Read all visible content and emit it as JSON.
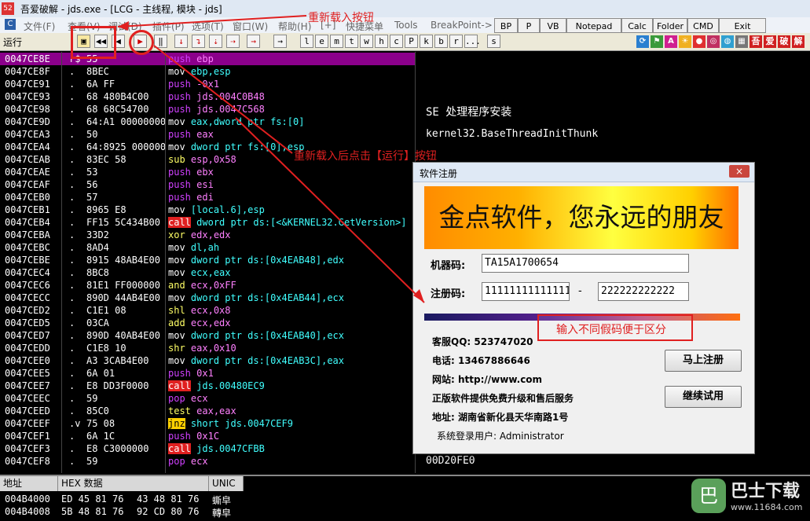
{
  "window": {
    "title": "吾爱破解 - jds.exe - [LCG - 主线程, 模块 - jds]",
    "icon": "52"
  },
  "menu": {
    "items": [
      "文件(F)",
      "查看(V)",
      "调试(D)",
      "插件(P)",
      "选项(T)",
      "窗口(W)",
      "帮助(H)",
      "[+]",
      "快捷菜单",
      "Tools",
      "BreakPoint->"
    ]
  },
  "plugin_buttons": [
    "BP",
    "P",
    "VB",
    "Notepad",
    "Calc",
    "Folder",
    "CMD",
    "Exit"
  ],
  "toolbar": {
    "status": "运行",
    "letters": [
      "l",
      "e",
      "m",
      "t",
      "w",
      "h",
      "c",
      "P",
      "k",
      "b",
      "r",
      "...",
      "s"
    ]
  },
  "disasm_rows": [
    {
      "addr": "0047CE8E",
      "mark": "r$",
      "hex": "55",
      "op": "push",
      "args": "ebp",
      "cls": "kw-push"
    },
    {
      "addr": "0047CE8F",
      "mark": ".",
      "hex": "8BEC",
      "op": "mov",
      "args": "ebp,esp",
      "cls": "kw-mov"
    },
    {
      "addr": "0047CE91",
      "mark": ".",
      "hex": "6A FF",
      "op": "push",
      "args": "-0x1",
      "cls": "kw-push"
    },
    {
      "addr": "0047CE93",
      "mark": ".",
      "hex": "68 480B4C00",
      "op": "push",
      "args": "jds.004C0B48",
      "cls": "kw-push"
    },
    {
      "addr": "0047CE98",
      "mark": ".",
      "hex": "68 68C54700",
      "op": "push",
      "args": "jds.0047C568",
      "cls": "kw-push"
    },
    {
      "addr": "0047CE9D",
      "mark": ".",
      "hex": "64:A1 00000000",
      "op": "mov",
      "args": "eax,dword ptr fs:[0]",
      "cls": "kw-mov"
    },
    {
      "addr": "0047CEA3",
      "mark": ".",
      "hex": "50",
      "op": "push",
      "args": "eax",
      "cls": "kw-push"
    },
    {
      "addr": "0047CEA4",
      "mark": ".",
      "hex": "64:8925 00000000",
      "op": "mov",
      "args": "dword ptr fs:[0],esp",
      "cls": "kw-mov"
    },
    {
      "addr": "0047CEAB",
      "mark": ".",
      "hex": "83EC 58",
      "op": "sub",
      "args": "esp,0x58",
      "cls": "kw-arith"
    },
    {
      "addr": "0047CEAE",
      "mark": ".",
      "hex": "53",
      "op": "push",
      "args": "ebx",
      "cls": "kw-push"
    },
    {
      "addr": "0047CEAF",
      "mark": ".",
      "hex": "56",
      "op": "push",
      "args": "esi",
      "cls": "kw-push"
    },
    {
      "addr": "0047CEB0",
      "mark": ".",
      "hex": "57",
      "op": "push",
      "args": "edi",
      "cls": "kw-push"
    },
    {
      "addr": "0047CEB1",
      "mark": ".",
      "hex": "8965 E8",
      "op": "mov",
      "args": "[local.6],esp",
      "cls": "kw-mov"
    },
    {
      "addr": "0047CEB4",
      "mark": ".",
      "hex": "FF15 5C434B00",
      "op": "call",
      "args": "dword ptr ds:[<&KERNEL32.GetVersion>]",
      "cls": "kw-call"
    },
    {
      "addr": "0047CEBA",
      "mark": ".",
      "hex": "33D2",
      "op": "xor",
      "args": "edx,edx",
      "cls": "kw-arith"
    },
    {
      "addr": "0047CEBC",
      "mark": ".",
      "hex": "8AD4",
      "op": "mov",
      "args": "dl,ah",
      "cls": "kw-mov"
    },
    {
      "addr": "0047CEBE",
      "mark": ".",
      "hex": "8915 48AB4E00",
      "op": "mov",
      "args": "dword ptr ds:[0x4EAB48],edx",
      "cls": "kw-mov"
    },
    {
      "addr": "0047CEC4",
      "mark": ".",
      "hex": "8BC8",
      "op": "mov",
      "args": "ecx,eax",
      "cls": "kw-mov"
    },
    {
      "addr": "0047CEC6",
      "mark": ".",
      "hex": "81E1 FF000000",
      "op": "and",
      "args": "ecx,0xFF",
      "cls": "kw-arith"
    },
    {
      "addr": "0047CECC",
      "mark": ".",
      "hex": "890D 44AB4E00",
      "op": "mov",
      "args": "dword ptr ds:[0x4EAB44],ecx",
      "cls": "kw-mov"
    },
    {
      "addr": "0047CED2",
      "mark": ".",
      "hex": "C1E1 08",
      "op": "shl",
      "args": "ecx,0x8",
      "cls": "kw-arith"
    },
    {
      "addr": "0047CED5",
      "mark": ".",
      "hex": "03CA",
      "op": "add",
      "args": "ecx,edx",
      "cls": "kw-arith"
    },
    {
      "addr": "0047CED7",
      "mark": ".",
      "hex": "890D 40AB4E00",
      "op": "mov",
      "args": "dword ptr ds:[0x4EAB40],ecx",
      "cls": "kw-mov"
    },
    {
      "addr": "0047CEDD",
      "mark": ".",
      "hex": "C1E8 10",
      "op": "shr",
      "args": "eax,0x10",
      "cls": "kw-arith"
    },
    {
      "addr": "0047CEE0",
      "mark": ".",
      "hex": "A3 3CAB4E00",
      "op": "mov",
      "args": "dword ptr ds:[0x4EAB3C],eax",
      "cls": "kw-mov"
    },
    {
      "addr": "0047CEE5",
      "mark": ".",
      "hex": "6A 01",
      "op": "push",
      "args": "0x1",
      "cls": "kw-push"
    },
    {
      "addr": "0047CEE7",
      "mark": ".",
      "hex": "E8 DD3F0000",
      "op": "call",
      "args": "jds.00480EC9",
      "cls": "kw-call"
    },
    {
      "addr": "0047CEEC",
      "mark": ".",
      "hex": "59",
      "op": "pop",
      "args": "ecx",
      "cls": "kw-push"
    },
    {
      "addr": "0047CEED",
      "mark": ".",
      "hex": "85C0",
      "op": "test",
      "args": "eax,eax",
      "cls": "kw-arith"
    },
    {
      "addr": "0047CEEF",
      "mark": ".v",
      "hex": "75 08",
      "op": "jnz",
      "args": "short jds.0047CEF9",
      "cls": "kw-jnz"
    },
    {
      "addr": "0047CEF1",
      "mark": ".",
      "hex": "6A 1C",
      "op": "push",
      "args": "0x1C",
      "cls": "kw-push"
    },
    {
      "addr": "0047CEF3",
      "mark": ".",
      "hex": "E8 C3000000",
      "op": "call",
      "args": "jds.0047CFBB",
      "cls": "kw-call"
    },
    {
      "addr": "0047CEF8",
      "mark": ".",
      "hex": "59",
      "op": "pop",
      "args": "ecx",
      "cls": "kw-push"
    }
  ],
  "comments": {
    "seh": "SE 处理程序安装",
    "thunk": "kernel32.BaseThreadInitThunk",
    "stack": "00D20FE0"
  },
  "dump": {
    "headers": [
      "地址",
      "HEX 数据",
      "UNIC"
    ],
    "rows": [
      {
        "addr": "004B4000",
        "hex1": "ED 45 81 76",
        "hex2": "43 48 81 76",
        "text": "蟖皁"
      },
      {
        "addr": "004B4008",
        "hex1": "5B 48 81 76",
        "hex2": "92 CD 80 76",
        "text": "轉皁"
      }
    ]
  },
  "dialog": {
    "title": "软件注册",
    "close": "×",
    "banner": "金点软件，您永远的朋友",
    "machine_label": "机器码:",
    "machine_code": "TA15A1700654",
    "reg_label": "注册码:",
    "reg_part1": "111111111111111",
    "reg_dash": "-",
    "reg_part2": "222222222222",
    "qq": "客服QQ: 523747020",
    "phone": "电话: 13467886646",
    "site": "网站: http://www.com",
    "promo": "正版软件提供免费升级和售后服务",
    "address": "地址: 湖南省新化县天华南路1号",
    "user": "系统登录用户:    Administrator",
    "register_btn": "马上注册",
    "trial_btn": "继续试用"
  },
  "annotations": {
    "reload": "重新载入按钮",
    "run": "重新载入后点击【运行】按钮",
    "fake_code": "输入不同假码便于区分"
  },
  "watermark": {
    "name": "巴士下载",
    "url": "www.11684.com",
    "icon": "巴"
  },
  "colors": {
    "selected_row": "#8b008b",
    "call_bg": "#e02020",
    "annotation": "#e02020"
  }
}
